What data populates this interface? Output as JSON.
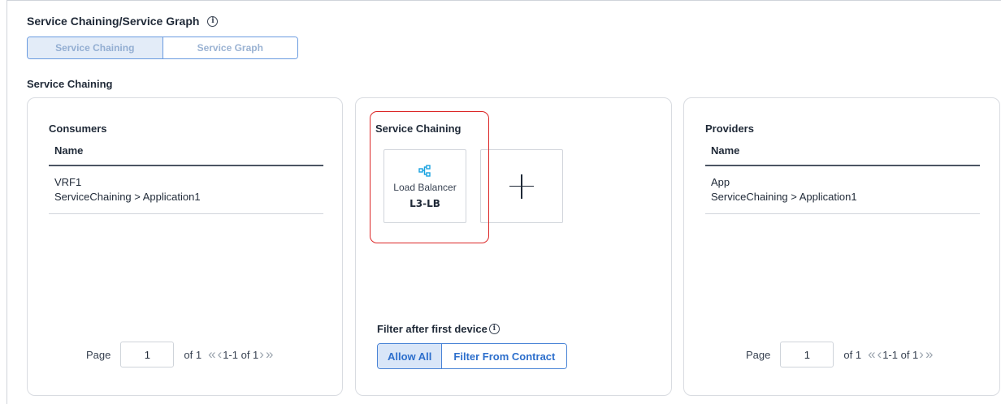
{
  "page": {
    "title": "Service Chaining/Service Graph",
    "info_icon": "i",
    "segmented": {
      "options": [
        "Service Chaining",
        "Service Graph"
      ],
      "selected": "Service Chaining"
    },
    "section_title": "Service Chaining"
  },
  "consumers": {
    "title": "Consumers",
    "column_header": "Name",
    "rows": [
      {
        "line1": "VRF1",
        "line2": "ServiceChaining > Application1"
      }
    ],
    "pager": {
      "page_label": "Page",
      "page_value": "1",
      "of_label": "of 1",
      "range_label": "1-1 of 1"
    }
  },
  "service_chaining": {
    "title": "Service Chaining",
    "devices": [
      {
        "icon": "load-balancer-icon",
        "type_label": "Load Balancer",
        "name": "L3-LB"
      }
    ],
    "add_icon": "plus-icon",
    "filter": {
      "label": "Filter after first device",
      "info_icon": "i",
      "options": [
        "Allow All",
        "Filter From Contract"
      ],
      "selected": "Allow All"
    }
  },
  "providers": {
    "title": "Providers",
    "column_header": "Name",
    "rows": [
      {
        "line1": "App",
        "line2": "ServiceChaining > Application1"
      }
    ],
    "pager": {
      "page_label": "Page",
      "page_value": "1",
      "of_label": "of 1",
      "range_label": "1-1 of 1"
    }
  },
  "colors": {
    "accent": "#2d6fcc",
    "highlight": "#dc2626",
    "icon_blue": "#1aa3e0"
  }
}
